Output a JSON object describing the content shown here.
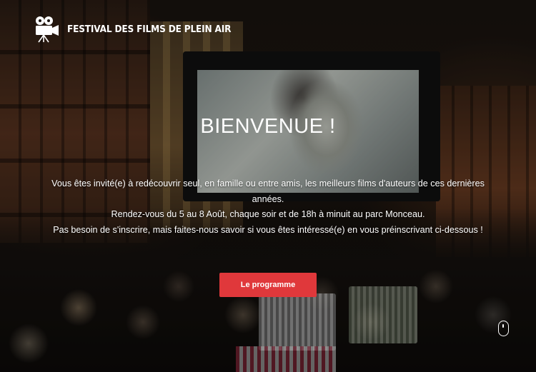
{
  "header": {
    "site_title": "FESTIVAL DES FILMS DE PLEIN AIR",
    "logo_icon": "film-camera-icon"
  },
  "hero": {
    "headline": "BIENVENUE !",
    "paragraph_lines": [
      "Vous êtes invité(e) à redécouvrir seul, en famille ou entre amis, les meilleurs films d'auteurs de ces dernières années.",
      "Rendez-vous du 5 au 8 Août, chaque soir et de 18h à minuit au parc Monceau.",
      "Pas besoin de s'inscrire, mais faites-nous savoir si vous êtes intéressé(e) en vous préinscrivant ci-dessous !"
    ],
    "cta_label": "Le programme",
    "scroll_icon": "mouse-scroll-icon"
  },
  "colors": {
    "accent": "#e0383b",
    "text": "#ffffff"
  }
}
